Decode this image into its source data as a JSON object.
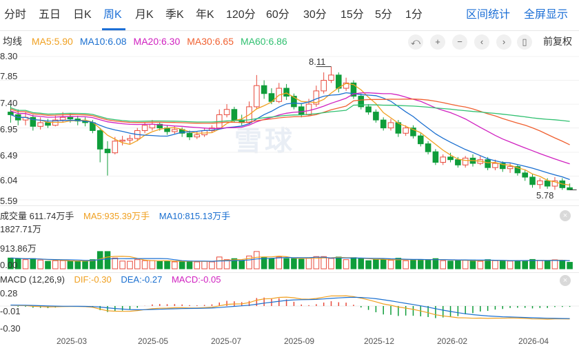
{
  "tabs": {
    "items": [
      "分时",
      "五日",
      "日K",
      "周K",
      "月K",
      "季K",
      "年K",
      "120分",
      "60分",
      "30分",
      "15分",
      "5分",
      "1分"
    ],
    "active_index": 3,
    "right_links": [
      "区间统计",
      "全屏显示"
    ]
  },
  "ma_legend": {
    "label": "均线",
    "items": [
      {
        "text": "MA5:5.90",
        "color": "#f0a020"
      },
      {
        "text": "MA10:6.08",
        "color": "#1a6fd0"
      },
      {
        "text": "MA20:6.30",
        "color": "#d020c0"
      },
      {
        "text": "MA30:6.65",
        "color": "#f06030"
      },
      {
        "text": "MA60:6.86",
        "color": "#30c070"
      }
    ]
  },
  "controls": {
    "icons": [
      "undo-icon",
      "zoom-in-icon",
      "zoom-out-icon",
      "prev-icon",
      "next-icon",
      "candle-icon"
    ],
    "glyphs": [
      "⤺",
      "+",
      "−",
      "‹",
      "›",
      "▯"
    ],
    "fq_label": "前复权"
  },
  "price_axis": [
    "8.30",
    "7.85",
    "7.40",
    "6.95",
    "6.49",
    "6.04",
    "5.59"
  ],
  "high_marker": "8.11",
  "low_marker": "5.78",
  "watermark": "雪球",
  "volume": {
    "label": "成交量 611.74万手",
    "ma5": "MA5:935.39万手",
    "ma10": "MA10:815.13万手",
    "axis": [
      "1827.71万",
      "913.86万",
      "0.00"
    ]
  },
  "macd": {
    "label": "MACD (12,26,9)",
    "dif": "DIF:-0.30",
    "dea": "DEA:-0.27",
    "macd": "MACD:-0.05",
    "axis": [
      "0.28",
      "-0.01",
      "-0.30"
    ]
  },
  "x_axis": [
    "2025-03",
    "2025-05",
    "2025-07",
    "2025-09",
    "2025-12",
    "2026-02",
    "2026-04"
  ],
  "colors": {
    "up": "#e84a3c",
    "down": "#0f9d3a",
    "accent": "#1c6fd6"
  },
  "chart_data": {
    "type": "candlestick",
    "period": "weekly",
    "price_range": [
      5.59,
      8.3
    ],
    "candles": [
      [
        7.25,
        7.2,
        7.38,
        7.05
      ],
      [
        7.2,
        7.1,
        7.3,
        7.0
      ],
      [
        7.1,
        7.15,
        7.25,
        7.0
      ],
      [
        7.15,
        6.98,
        7.2,
        6.9
      ],
      [
        6.98,
        7.05,
        7.15,
        6.92
      ],
      [
        7.05,
        7.0,
        7.12,
        6.95
      ],
      [
        7.0,
        7.1,
        7.18,
        6.98
      ],
      [
        7.1,
        7.15,
        7.25,
        7.05
      ],
      [
        7.15,
        7.12,
        7.22,
        7.05
      ],
      [
        7.12,
        7.08,
        7.18,
        7.0
      ],
      [
        7.08,
        7.05,
        7.15,
        6.98
      ],
      [
        7.05,
        6.9,
        7.1,
        6.85
      ],
      [
        6.9,
        6.55,
        6.95,
        6.3
      ],
      [
        6.55,
        6.48,
        6.7,
        6.05
      ],
      [
        6.48,
        6.7,
        6.78,
        6.45
      ],
      [
        6.7,
        6.72,
        6.8,
        6.62
      ],
      [
        6.72,
        6.75,
        6.82,
        6.65
      ],
      [
        6.75,
        6.9,
        6.95,
        6.7
      ],
      [
        6.9,
        7.0,
        7.05,
        6.85
      ],
      [
        6.95,
        7.02,
        7.1,
        6.9
      ],
      [
        7.02,
        6.95,
        7.06,
        6.9
      ],
      [
        6.95,
        6.88,
        7.0,
        6.82
      ],
      [
        6.88,
        6.92,
        6.98,
        6.84
      ],
      [
        6.92,
        6.85,
        6.96,
        6.78
      ],
      [
        6.85,
        6.78,
        6.9,
        6.72
      ],
      [
        6.78,
        6.82,
        6.88,
        6.74
      ],
      [
        6.82,
        6.9,
        6.95,
        6.78
      ],
      [
        6.9,
        6.95,
        7.0,
        6.86
      ],
      [
        6.95,
        7.2,
        7.3,
        6.92
      ],
      [
        7.2,
        7.3,
        7.4,
        7.15
      ],
      [
        7.3,
        7.1,
        7.35,
        7.05
      ],
      [
        7.1,
        7.05,
        7.2,
        7.0
      ],
      [
        7.05,
        7.35,
        7.45,
        7.02
      ],
      [
        7.35,
        7.75,
        7.95,
        7.3
      ],
      [
        7.75,
        7.6,
        7.85,
        7.5
      ],
      [
        7.6,
        7.45,
        7.7,
        7.4
      ],
      [
        7.45,
        7.7,
        7.8,
        7.42
      ],
      [
        7.7,
        7.55,
        7.78,
        7.48
      ],
      [
        7.55,
        7.35,
        7.6,
        7.3
      ],
      [
        7.35,
        7.2,
        7.42,
        7.15
      ],
      [
        7.2,
        7.4,
        7.5,
        7.18
      ],
      [
        7.4,
        7.65,
        7.75,
        7.35
      ],
      [
        7.65,
        7.85,
        8.0,
        7.6
      ],
      [
        7.85,
        7.95,
        8.11,
        7.8
      ],
      [
        7.95,
        7.7,
        8.0,
        7.62
      ],
      [
        7.7,
        7.8,
        7.9,
        7.65
      ],
      [
        7.8,
        7.55,
        7.85,
        7.5
      ],
      [
        7.55,
        7.35,
        7.6,
        7.3
      ],
      [
        7.35,
        7.25,
        7.4,
        7.2
      ],
      [
        7.25,
        7.1,
        7.3,
        7.05
      ],
      [
        7.1,
        6.95,
        7.15,
        6.9
      ],
      [
        6.95,
        7.05,
        7.12,
        6.9
      ],
      [
        7.05,
        6.85,
        7.1,
        6.78
      ],
      [
        6.85,
        6.95,
        7.0,
        6.8
      ],
      [
        6.95,
        6.8,
        7.0,
        6.75
      ],
      [
        6.8,
        6.65,
        6.85,
        6.6
      ],
      [
        6.65,
        6.5,
        6.7,
        6.45
      ],
      [
        6.5,
        6.3,
        6.55,
        6.25
      ],
      [
        6.3,
        6.4,
        6.45,
        6.25
      ],
      [
        6.4,
        6.35,
        6.48,
        6.3
      ],
      [
        6.35,
        6.25,
        6.4,
        6.2
      ],
      [
        6.25,
        6.38,
        6.42,
        6.2
      ],
      [
        6.38,
        6.28,
        6.45,
        6.22
      ],
      [
        6.28,
        6.35,
        6.42,
        6.25
      ],
      [
        6.35,
        6.2,
        6.4,
        6.15
      ],
      [
        6.2,
        6.28,
        6.35,
        6.15
      ],
      [
        6.28,
        6.18,
        6.32,
        6.12
      ],
      [
        6.18,
        6.22,
        6.28,
        6.1
      ],
      [
        6.22,
        6.1,
        6.25,
        6.05
      ],
      [
        6.1,
        6.02,
        6.15,
        5.95
      ],
      [
        6.02,
        5.88,
        6.08,
        5.82
      ],
      [
        5.88,
        5.95,
        6.0,
        5.8
      ],
      [
        5.95,
        5.85,
        6.0,
        5.8
      ],
      [
        5.85,
        5.95,
        6.02,
        5.78
      ],
      [
        5.95,
        5.82,
        6.0,
        5.78
      ],
      [
        5.82,
        5.78,
        5.9,
        5.78
      ]
    ]
  }
}
